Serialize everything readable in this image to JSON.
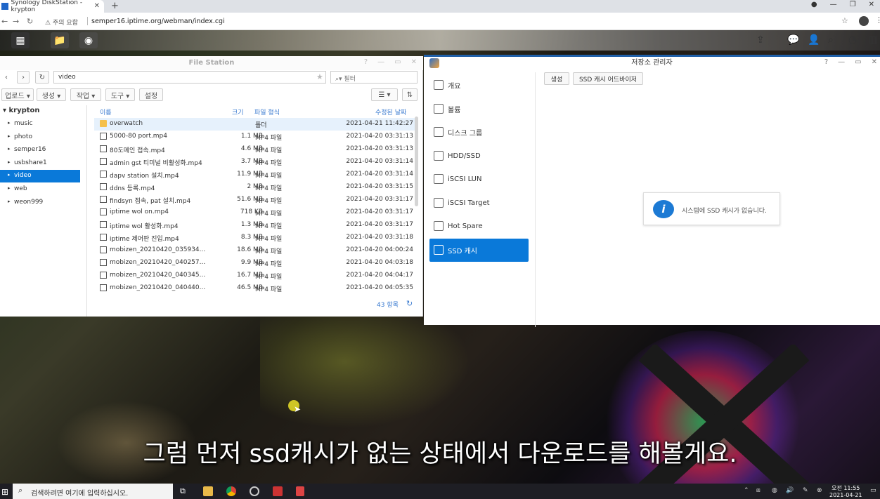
{
  "browser": {
    "tab_title": "Synology DiskStation - krypton",
    "new_tab": "+",
    "security_warning": "주의 요함",
    "url": "semper16.iptime.org/webman/index.cgi"
  },
  "file_station": {
    "title": "File Station",
    "path": "video",
    "filter_placeholder": "필터",
    "toolbar": [
      "업로드 ▾",
      "생성 ▾",
      "작업 ▾",
      "도구 ▾",
      "설정"
    ],
    "tree_root": "krypton",
    "tree_items": [
      {
        "label": "music",
        "selected": false
      },
      {
        "label": "photo",
        "selected": false
      },
      {
        "label": "semper16",
        "selected": false
      },
      {
        "label": "usbshare1",
        "selected": false
      },
      {
        "label": "video",
        "selected": true
      },
      {
        "label": "web",
        "selected": false
      },
      {
        "label": "weon999",
        "selected": false
      }
    ],
    "columns": {
      "name": "이름",
      "size": "크기",
      "type": "파일 형식",
      "modified": "수정된 날짜"
    },
    "files": [
      {
        "name": "overwatch",
        "size": "",
        "type": "폴더",
        "modified": "2021-04-21 11:42:27",
        "folder": true
      },
      {
        "name": "5000-80 port.mp4",
        "size": "1.1 MB",
        "type": "MP4 파일",
        "modified": "2021-04-20 03:31:13"
      },
      {
        "name": "80도메인 접속.mp4",
        "size": "4.6 MB",
        "type": "MP4 파일",
        "modified": "2021-04-20 03:31:13"
      },
      {
        "name": "admin gst 티미널 비활성화.mp4",
        "size": "3.7 MB",
        "type": "MP4 파일",
        "modified": "2021-04-20 03:31:14"
      },
      {
        "name": "dapv station 설치.mp4",
        "size": "11.9 MB",
        "type": "MP4 파일",
        "modified": "2021-04-20 03:31:14"
      },
      {
        "name": "ddns 등록.mp4",
        "size": "2 MB",
        "type": "MP4 파일",
        "modified": "2021-04-20 03:31:15"
      },
      {
        "name": "findsyn 접속, pat 설치.mp4",
        "size": "51.6 MB",
        "type": "MP4 파일",
        "modified": "2021-04-20 03:31:17"
      },
      {
        "name": "iptime wol on.mp4",
        "size": "718 KB",
        "type": "MP4 파일",
        "modified": "2021-04-20 03:31:17"
      },
      {
        "name": "iptime wol 활성화.mp4",
        "size": "1.3 MB",
        "type": "MP4 파일",
        "modified": "2021-04-20 03:31:17"
      },
      {
        "name": "iptime 제어판 진입.mp4",
        "size": "8.3 MB",
        "type": "MP4 파일",
        "modified": "2021-04-20 03:31:18"
      },
      {
        "name": "mobizen_20210420_035934...",
        "size": "18.6 MB",
        "type": "MP4 파일",
        "modified": "2021-04-20 04:00:24"
      },
      {
        "name": "mobizen_20210420_040257...",
        "size": "9.9 MB",
        "type": "MP4 파일",
        "modified": "2021-04-20 04:03:18"
      },
      {
        "name": "mobizen_20210420_040345...",
        "size": "16.7 MB",
        "type": "MP4 파일",
        "modified": "2021-04-20 04:04:17"
      },
      {
        "name": "mobizen_20210420_040440...",
        "size": "46.5 MB",
        "type": "MP4 파일",
        "modified": "2021-04-20 04:05:35"
      }
    ],
    "item_count": "43 항목"
  },
  "storage_manager": {
    "title": "저장소 관리자",
    "sidebar": [
      {
        "label": "개요",
        "icon": "overview-icon",
        "selected": false
      },
      {
        "label": "볼륨",
        "icon": "volume-icon",
        "selected": false
      },
      {
        "label": "디스크 그룹",
        "icon": "disk-group-icon",
        "selected": false
      },
      {
        "label": "HDD/SSD",
        "icon": "hdd-icon",
        "selected": false
      },
      {
        "label": "iSCSI LUN",
        "icon": "iscsi-lun-icon",
        "selected": false
      },
      {
        "label": "iSCSI Target",
        "icon": "iscsi-target-icon",
        "selected": false
      },
      {
        "label": "Hot Spare",
        "icon": "hot-spare-icon",
        "selected": false
      },
      {
        "label": "SSD 캐시",
        "icon": "ssd-cache-icon",
        "selected": true
      }
    ],
    "buttons": {
      "create": "생성",
      "advisor": "SSD 캐시 어드바이저"
    },
    "info_message": "시스템에 SSD 캐시가 없습니다."
  },
  "subtitle": "그럼 먼저 ssd캐시가 없는 상태에서 다운로드를 해볼게요.",
  "taskbar": {
    "search_placeholder": "검색하려면 여기에 입력하십시오.",
    "time": "오전 11:55",
    "date": "2021-04-21"
  },
  "colors": {
    "accent": "#0a79d9",
    "dsm_blue": "#1f5fa8"
  }
}
